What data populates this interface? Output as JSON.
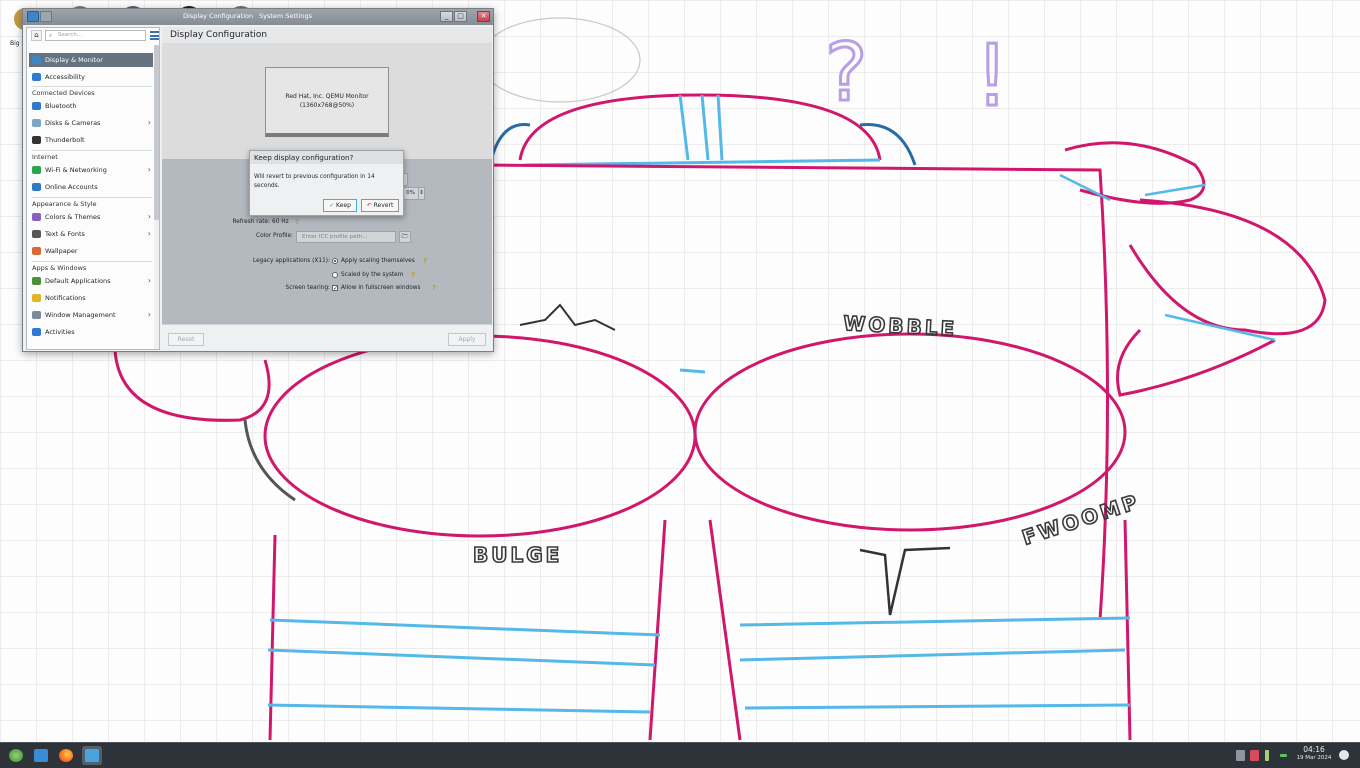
{
  "window": {
    "tabs": [
      "Display Configuration",
      "System Settings"
    ],
    "buttons": {
      "minimize": "_",
      "maximize": "□",
      "close": "✕"
    }
  },
  "sidebar": {
    "search_placeholder": "Search...",
    "home_icon": "⌂",
    "items_top": [
      {
        "label": "Display & Monitor",
        "icon": "monitor-icon",
        "color": "#3c86c7",
        "active": true
      },
      {
        "label": "Accessibility",
        "icon": "accessibility-icon",
        "color": "#2f7ad3"
      }
    ],
    "sections": [
      {
        "heading": "Connected Devices",
        "items": [
          {
            "label": "Bluetooth",
            "icon": "bluetooth-icon",
            "color": "#2f79c5",
            "chevron": false
          },
          {
            "label": "Disks & Cameras",
            "icon": "disks-icon",
            "color": "#7ea6c4",
            "chevron": true
          },
          {
            "label": "Thunderbolt",
            "icon": "thunderbolt-icon",
            "color": "#333333",
            "chevron": false
          }
        ]
      },
      {
        "heading": "Internet",
        "items": [
          {
            "label": "Wi-Fi & Networking",
            "icon": "network-icon",
            "color": "#2ba34f",
            "chevron": true
          },
          {
            "label": "Online Accounts",
            "icon": "online-accounts-icon",
            "color": "#2f79c5",
            "chevron": false
          }
        ]
      },
      {
        "heading": "Appearance & Style",
        "items": [
          {
            "label": "Colors & Themes",
            "icon": "colors-icon",
            "color": "#8a5fbf",
            "chevron": true
          },
          {
            "label": "Text & Fonts",
            "icon": "fonts-icon",
            "color": "#555555",
            "chevron": true
          },
          {
            "label": "Wallpaper",
            "icon": "wallpaper-icon",
            "color": "#d9683a",
            "chevron": false
          }
        ]
      },
      {
        "heading": "Apps & Windows",
        "items": [
          {
            "label": "Default Applications",
            "icon": "default-apps-icon",
            "color": "#4b8f3a",
            "chevron": true
          },
          {
            "label": "Notifications",
            "icon": "bell-icon",
            "color": "#e5b425",
            "chevron": false
          },
          {
            "label": "Window Management",
            "icon": "window-management-icon",
            "color": "#7a8a99",
            "chevron": true
          },
          {
            "label": "Activities",
            "icon": "activities-icon",
            "color": "#2f7ad3",
            "chevron": false
          }
        ]
      }
    ]
  },
  "main": {
    "title": "Display Configuration",
    "monitor_name": "Red Hat, Inc. QEMU Monitor",
    "monitor_mode": "(1360x768@50%)",
    "scale_value": "0%",
    "refresh_label": "Refresh rate:",
    "refresh_value": "60 Hz",
    "color_profile_label": "Color Profile:",
    "color_profile_placeholder": "Enter ICC profile path...",
    "legacy_label": "Legacy applications (X11):",
    "legacy_opt1": "Apply scaling themselves",
    "legacy_opt2": "Scaled by the system",
    "tearing_label": "Screen tearing:",
    "tearing_opt": "Allow in fullscreen windows",
    "reset_label": "Reset",
    "apply_label": "Apply",
    "help_glyph": "?"
  },
  "dialog": {
    "title": "Keep display configuration?",
    "message": "Will revert to previous configuration in 14 seconds.",
    "keep_label": "Keep",
    "revert_label": "Revert"
  },
  "wallpaper_text": {
    "words": [
      "WOBBLE",
      "BULGE",
      "FWOOMP"
    ],
    "question": "?",
    "exclaim": "!"
  },
  "taskbar": {
    "apps": [
      "application-launcher-icon",
      "file-manager-icon",
      "firefox-icon",
      "system-settings-icon"
    ],
    "time": "04:16",
    "date": "19 Mar 2024"
  },
  "desktop": {
    "label": "Big Se"
  }
}
